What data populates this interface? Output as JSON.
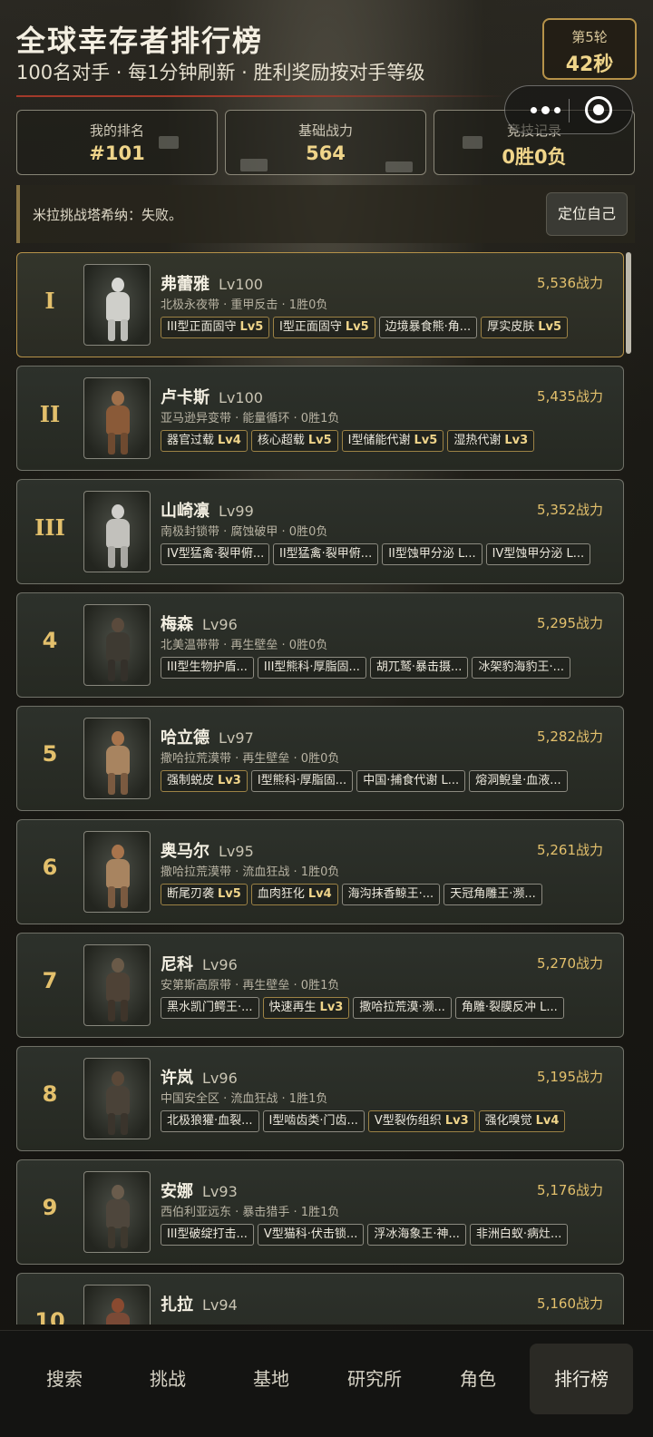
{
  "header": {
    "title": "全球幸存者排行榜",
    "subtitle": "100名对手 · 每1分钟刷新 · 胜利奖励按对手等级",
    "round_label": "第5轮",
    "round_time": "42秒"
  },
  "stats": [
    {
      "label": "我的排名",
      "value": "#101"
    },
    {
      "label": "基础战力",
      "value": "564"
    },
    {
      "label": "竞技记录",
      "value": "0胜0负"
    }
  ],
  "message": "米拉挑战塔希纳：失败。",
  "locate_button": "定位自己",
  "players": [
    {
      "rank": "I",
      "name": "弗蕾雅",
      "level": "Lv100",
      "power": "5,536战力",
      "desc": "北极永夜带 · 重甲反击 · 1胜0负",
      "tags": [
        {
          "text": "III型正面固守",
          "lv": "Lv5"
        },
        {
          "text": "I型正面固守",
          "lv": "Lv5"
        },
        {
          "text": "边境暴食熊·角...",
          "lv": ""
        },
        {
          "text": "厚实皮肤",
          "lv": "Lv5"
        }
      ]
    },
    {
      "rank": "II",
      "name": "卢卡斯",
      "level": "Lv100",
      "power": "5,435战力",
      "desc": "亚马逊异变带 · 能量循环 · 0胜1负",
      "tags": [
        {
          "text": "器官过载",
          "lv": "Lv4"
        },
        {
          "text": "核心超载",
          "lv": "Lv5"
        },
        {
          "text": "I型储能代谢",
          "lv": "Lv5"
        },
        {
          "text": "湿热代谢",
          "lv": "Lv3"
        }
      ]
    },
    {
      "rank": "III",
      "name": "山崎凛",
      "level": "Lv99",
      "power": "5,352战力",
      "desc": "南极封锁带 · 腐蚀破甲 · 0胜0负",
      "tags": [
        {
          "text": "IV型猛禽·裂甲俯...",
          "lv": ""
        },
        {
          "text": "II型猛禽·裂甲俯...",
          "lv": ""
        },
        {
          "text": "II型蚀甲分泌 L...",
          "lv": ""
        },
        {
          "text": "IV型蚀甲分泌 L...",
          "lv": ""
        }
      ]
    },
    {
      "rank": "4",
      "name": "梅森",
      "level": "Lv96",
      "power": "5,295战力",
      "desc": "北美温带带 · 再生壁垒 · 0胜0负",
      "tags": [
        {
          "text": "III型生物护盾...",
          "lv": ""
        },
        {
          "text": "III型熊科·厚脂固...",
          "lv": ""
        },
        {
          "text": "胡兀鹫·暴击摄...",
          "lv": ""
        },
        {
          "text": "冰架豹海豹王·...",
          "lv": ""
        }
      ]
    },
    {
      "rank": "5",
      "name": "哈立德",
      "level": "Lv97",
      "power": "5,282战力",
      "desc": "撒哈拉荒漠带 · 再生壁垒 · 0胜0负",
      "tags": [
        {
          "text": "强制蜕皮",
          "lv": "Lv3"
        },
        {
          "text": "I型熊科·厚脂固...",
          "lv": ""
        },
        {
          "text": "中国·捕食代谢 L...",
          "lv": ""
        },
        {
          "text": "熔洞鲵皇·血液...",
          "lv": ""
        }
      ]
    },
    {
      "rank": "6",
      "name": "奥马尔",
      "level": "Lv95",
      "power": "5,261战力",
      "desc": "撒哈拉荒漠带 · 流血狂战 · 1胜0负",
      "tags": [
        {
          "text": "断尾刃袭",
          "lv": "Lv5"
        },
        {
          "text": "血肉狂化",
          "lv": "Lv4"
        },
        {
          "text": "海沟抹香鲸王·...",
          "lv": ""
        },
        {
          "text": "天冠角雕王·濒...",
          "lv": ""
        }
      ]
    },
    {
      "rank": "7",
      "name": "尼科",
      "level": "Lv96",
      "power": "5,270战力",
      "desc": "安第斯高原带 · 再生壁垒 · 0胜1负",
      "tags": [
        {
          "text": "黑水凯门鳄王·...",
          "lv": ""
        },
        {
          "text": "快速再生",
          "lv": "Lv3"
        },
        {
          "text": "撒哈拉荒漠·濒...",
          "lv": ""
        },
        {
          "text": "角雕·裂膜反冲 L...",
          "lv": ""
        }
      ]
    },
    {
      "rank": "8",
      "name": "许岚",
      "level": "Lv96",
      "power": "5,195战力",
      "desc": "中国安全区 · 流血狂战 · 1胜1负",
      "tags": [
        {
          "text": "北极狼獾·血裂...",
          "lv": ""
        },
        {
          "text": "I型啮齿类·门齿...",
          "lv": ""
        },
        {
          "text": "V型裂伤组织",
          "lv": "Lv3"
        },
        {
          "text": "强化嗅觉",
          "lv": "Lv4"
        }
      ]
    },
    {
      "rank": "9",
      "name": "安娜",
      "level": "Lv93",
      "power": "5,176战力",
      "desc": "西伯利亚远东 · 暴击猎手 · 1胜1负",
      "tags": [
        {
          "text": "III型破绽打击...",
          "lv": ""
        },
        {
          "text": "V型猫科·伏击锁...",
          "lv": ""
        },
        {
          "text": "浮冰海象王·神...",
          "lv": ""
        },
        {
          "text": "非洲白蚁·病灶...",
          "lv": ""
        }
      ]
    },
    {
      "rank": "10",
      "name": "扎拉",
      "level": "Lv94",
      "power": "5,160战力",
      "desc": "",
      "tags": []
    }
  ],
  "nav": [
    "搜索",
    "挑战",
    "基地",
    "研究所",
    "角色",
    "排行榜"
  ],
  "nav_active": "排行榜",
  "colors": {
    "accent_gold": "#e3c06c",
    "border_gold": "#b69249",
    "background": "#15140f"
  }
}
